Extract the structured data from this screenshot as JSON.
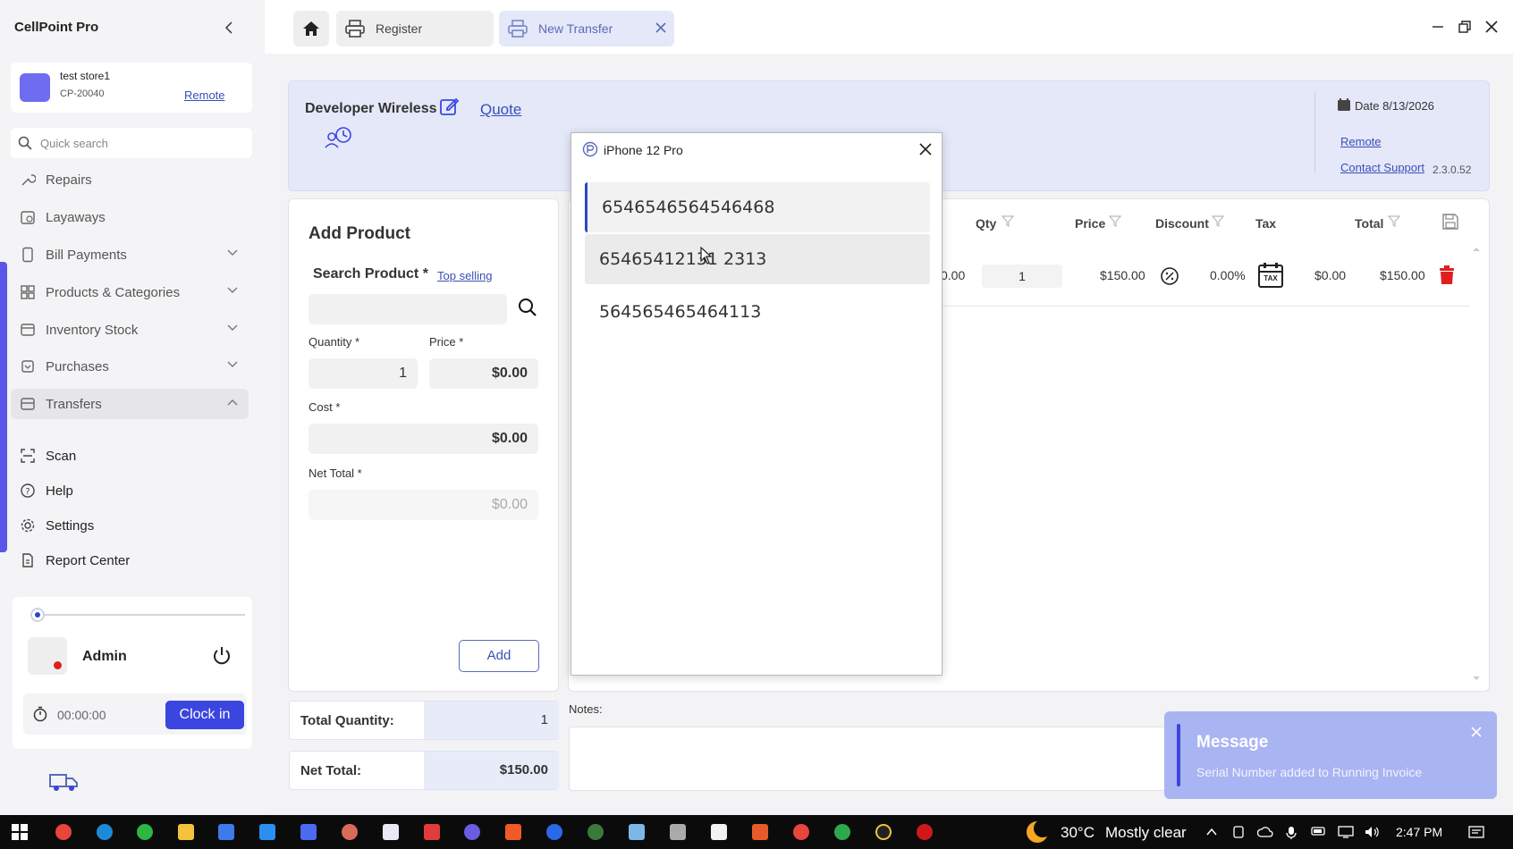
{
  "app": {
    "title": "CellPoint Pro"
  },
  "store": {
    "name": "test store1",
    "code": "CP-20040",
    "remote_label": "Remote"
  },
  "search": {
    "placeholder": "Quick search"
  },
  "sidebar": {
    "items": [
      {
        "label": "Repairs"
      },
      {
        "label": "Layaways"
      },
      {
        "label": "Bill Payments"
      },
      {
        "label": "Products & Categories"
      },
      {
        "label": "Inventory Stock"
      },
      {
        "label": "Purchases"
      },
      {
        "label": "Transfers"
      }
    ],
    "bottom_items": [
      {
        "label": "Scan"
      },
      {
        "label": "Help"
      },
      {
        "label": "Settings"
      },
      {
        "label": "Report Center"
      }
    ]
  },
  "user": {
    "name": "Admin",
    "timer": "00:00:00",
    "clock_in_label": "Clock in"
  },
  "tabs": [
    {
      "label": "Register"
    },
    {
      "label": "New Transfer"
    }
  ],
  "header": {
    "customer": "Developer Wireless",
    "quote_label": "Quote",
    "date_label": "Date 8/13/2026",
    "remote_label": "Remote",
    "support_label": "Contact Support",
    "version": "2.3.0.52"
  },
  "add_product": {
    "title": "Add Product",
    "search_label": "Search Product *",
    "top_selling_label": "Top selling",
    "search_value": "",
    "quantity_label": "Quantity *",
    "quantity_value": "1",
    "price_label": "Price *",
    "price_value": "$0.00",
    "cost_label": "Cost *",
    "cost_value": "$0.00",
    "net_total_label": "Net Total *",
    "net_total_value": "$0.00",
    "add_label": "Add"
  },
  "table": {
    "columns": [
      "Qty",
      "Price",
      "Discount",
      "Tax",
      "Total"
    ],
    "rows": [
      {
        "partial": "0.00",
        "qty": "1",
        "price": "$150.00",
        "discount": "0.00%",
        "tax": "$0.00",
        "total": "$150.00",
        "tax_badge": "TAX"
      }
    ]
  },
  "totals": {
    "quantity_label": "Total Quantity:",
    "quantity_value": "1",
    "net_label": "Net Total:",
    "net_value": "$150.00"
  },
  "notes": {
    "label": "Notes:",
    "value": ""
  },
  "popup": {
    "title": "iPhone 12 Pro",
    "serials": [
      "6546546564546468",
      "65465412131 2313",
      "564565465464113"
    ]
  },
  "toast": {
    "title": "Message",
    "message": "Serial Number added to Running Invoice"
  },
  "taskbar": {
    "temperature": "30°C",
    "condition": "Mostly clear",
    "time": "2:47 PM"
  },
  "colors": {
    "accent": "#3b45e0",
    "brand_avatar": "#6f6cf2",
    "header_panel": "#e4e8f8",
    "toast": "#a9b4f2",
    "delete": "#e01e1e"
  }
}
